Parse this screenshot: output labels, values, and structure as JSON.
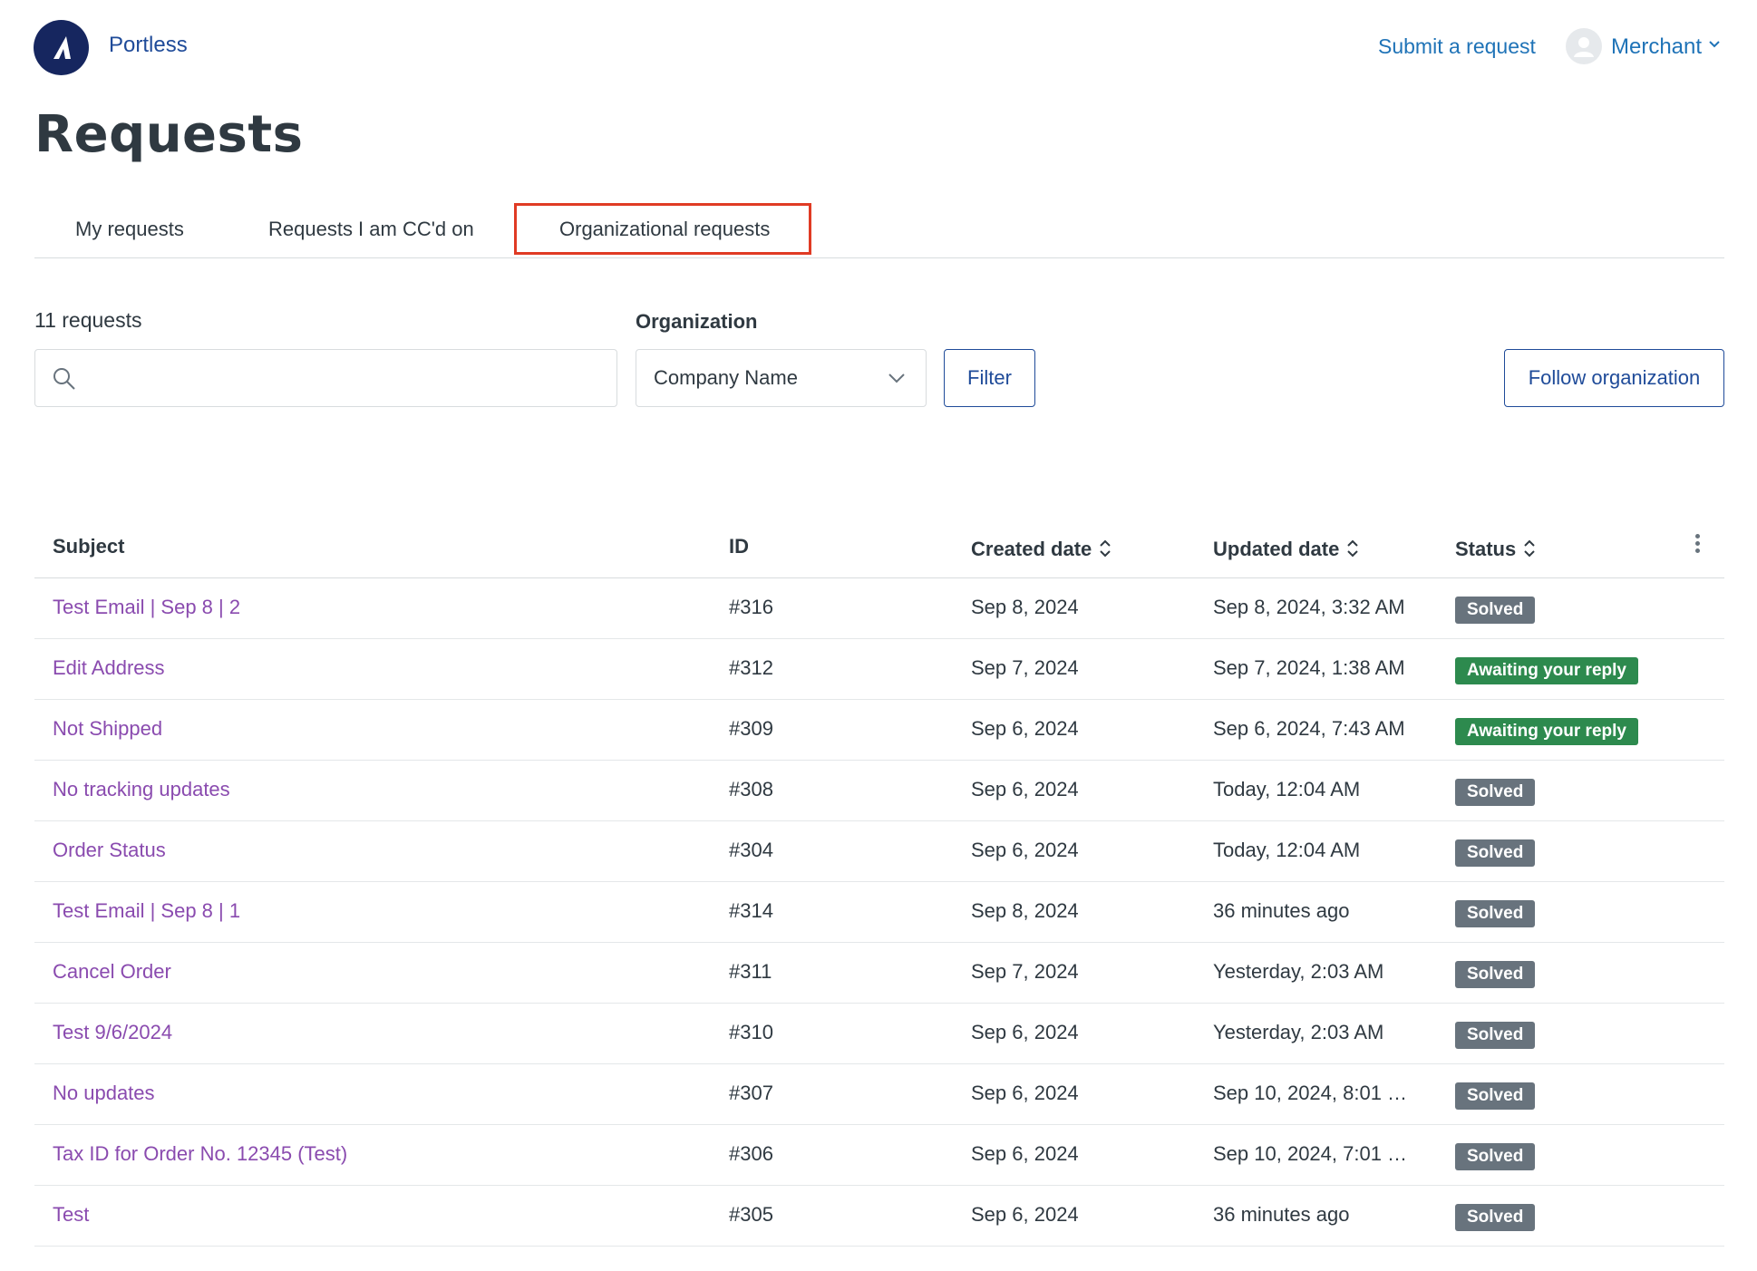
{
  "header": {
    "brand": "Portless",
    "submit_request": "Submit a request",
    "user_name": "Merchant"
  },
  "page_title": "Requests",
  "tabs": [
    {
      "label": "My requests"
    },
    {
      "label": "Requests I am CC'd on"
    },
    {
      "label": "Organizational requests",
      "selected": true
    }
  ],
  "filters": {
    "count": "11 requests",
    "search_value": "",
    "organization_label": "Organization",
    "organization_value": "Company Name",
    "filter_button": "Filter",
    "follow_button": "Follow organization"
  },
  "table": {
    "columns": {
      "subject": "Subject",
      "id": "ID",
      "created": "Created date",
      "updated": "Updated date",
      "status": "Status"
    },
    "rows": [
      {
        "subject": "Test Email | Sep 8 | 2",
        "id": "#316",
        "created": "Sep 8, 2024",
        "updated": "Sep 8, 2024, 3:32 AM",
        "status": "Solved"
      },
      {
        "subject": "Edit Address",
        "id": "#312",
        "created": "Sep 7, 2024",
        "updated": "Sep 7, 2024, 1:38 AM",
        "status": "Awaiting your reply"
      },
      {
        "subject": "Not Shipped",
        "id": "#309",
        "created": "Sep 6, 2024",
        "updated": "Sep 6, 2024, 7:43 AM",
        "status": "Awaiting your reply"
      },
      {
        "subject": "No tracking updates",
        "id": "#308",
        "created": "Sep 6, 2024",
        "updated": "Today, 12:04 AM",
        "status": "Solved"
      },
      {
        "subject": "Order Status",
        "id": "#304",
        "created": "Sep 6, 2024",
        "updated": "Today, 12:04 AM",
        "status": "Solved"
      },
      {
        "subject": "Test Email | Sep 8 | 1",
        "id": "#314",
        "created": "Sep 8, 2024",
        "updated": "36 minutes ago",
        "status": "Solved"
      },
      {
        "subject": "Cancel Order",
        "id": "#311",
        "created": "Sep 7, 2024",
        "updated": "Yesterday, 2:03 AM",
        "status": "Solved"
      },
      {
        "subject": "Test 9/6/2024",
        "id": "#310",
        "created": "Sep 6, 2024",
        "updated": "Yesterday, 2:03 AM",
        "status": "Solved"
      },
      {
        "subject": "No updates",
        "id": "#307",
        "created": "Sep 6, 2024",
        "updated": "Sep 10, 2024, 8:01 …",
        "status": "Solved"
      },
      {
        "subject": "Tax ID for Order No. 12345 (Test)",
        "id": "#306",
        "created": "Sep 6, 2024",
        "updated": "Sep 10, 2024, 7:01 …",
        "status": "Solved"
      },
      {
        "subject": "Test",
        "id": "#305",
        "created": "Sep 6, 2024",
        "updated": "36 minutes ago",
        "status": "Solved"
      }
    ]
  },
  "colors": {
    "brand_navy": "#16265f",
    "link_blue": "#1f73b7",
    "subject_purple": "#8a4baf",
    "solved_gray": "#68737d",
    "awaiting_green": "#2d8a4e",
    "highlight_red": "#e03b24"
  },
  "icons": [
    "logo-icon",
    "avatar-icon",
    "chevron-down-icon",
    "search-icon",
    "sort-icon",
    "more-options-icon"
  ]
}
